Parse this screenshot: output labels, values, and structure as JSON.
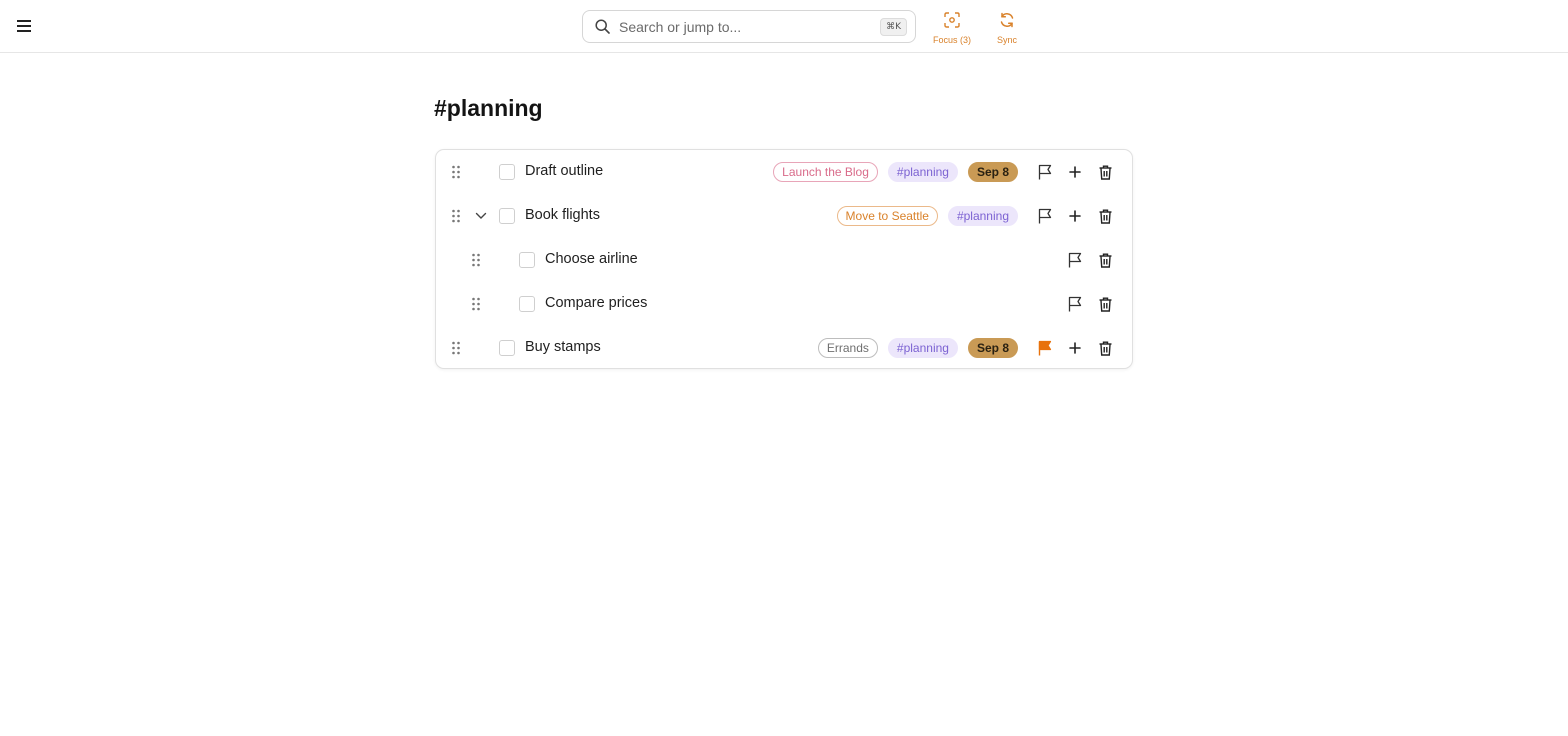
{
  "header": {
    "search": {
      "placeholder": "Search or jump to...",
      "shortcut": "⌘K"
    },
    "focus_label": "Focus (3)",
    "sync_label": "Sync"
  },
  "page": {
    "title": "#planning"
  },
  "colors": {
    "accent_orange": "#d9822b",
    "flag_active": "#e8720c",
    "date_chip": "#c99a55",
    "tag_chip_bg": "#ece6fb",
    "tag_chip_text": "#7c62d2"
  },
  "tasks": [
    {
      "title": "Draft outline",
      "project": "Launch the Blog",
      "project_color": "#d96b8a",
      "tag": "#planning",
      "due": "Sep 8",
      "flag": "outline",
      "level": 0
    },
    {
      "title": "Book flights",
      "project": "Move to Seattle",
      "project_color": "#d9822b",
      "tag": "#planning",
      "flag": "outline",
      "level": 0,
      "expandable": true,
      "expanded": true
    },
    {
      "title": "Choose airline",
      "flag": "outline",
      "level": 1
    },
    {
      "title": "Compare prices",
      "flag": "outline",
      "level": 1
    },
    {
      "title": "Buy stamps",
      "project": "Errands",
      "project_color": "#777777",
      "tag": "#planning",
      "due": "Sep 8",
      "flag": "filled",
      "level": 0
    }
  ]
}
